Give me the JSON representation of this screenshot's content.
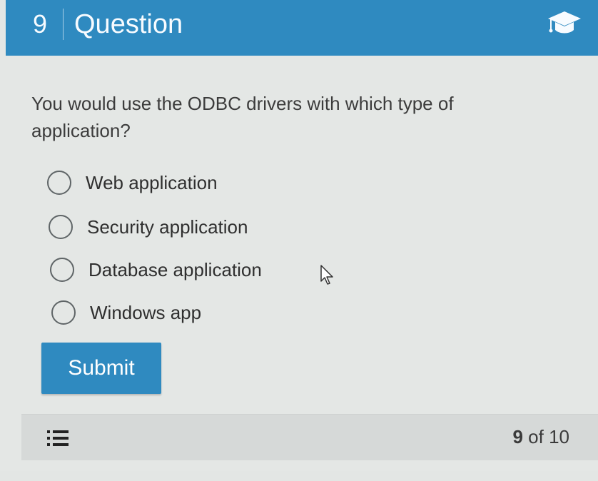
{
  "header": {
    "number": "9",
    "title": "Question",
    "icon": "graduation-cap-icon",
    "color": "#2f8ac0"
  },
  "question": {
    "text": "You would use the ODBC drivers with which type of application?"
  },
  "options": [
    {
      "label": "Web application",
      "selected": false
    },
    {
      "label": "Security application",
      "selected": false
    },
    {
      "label": "Database application",
      "selected": false
    },
    {
      "label": "Windows app",
      "selected": false
    }
  ],
  "submit": {
    "label": "Submit"
  },
  "footer": {
    "menu_icon": "list-icon",
    "current": "9",
    "of_text": "of 10"
  }
}
